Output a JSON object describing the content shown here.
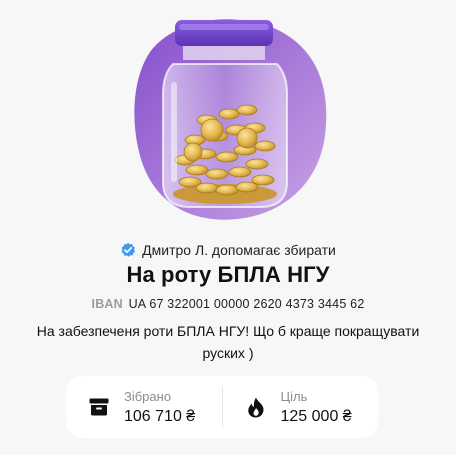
{
  "organizer": {
    "text": "Дмитро Л. допомагає збирати",
    "verified_icon": "verified-check-icon",
    "accent": "#3b9cf0"
  },
  "title": "На роту БПЛА НГУ",
  "iban": {
    "label": "IBAN",
    "number": "UA 67 322001 00000 2620 4373 3445 62"
  },
  "description": "На забезпеченя роти БПЛА НГУ! Що б краще покращувати руских )",
  "stats": {
    "collected": {
      "label": "Зібрано",
      "value": "106 710 ₴",
      "icon": "archive-box-icon"
    },
    "goal": {
      "label": "Ціль",
      "value": "125 000 ₴",
      "icon": "flame-icon"
    }
  },
  "jar": {
    "blob_color": "#b084d8",
    "lid_color": "#6a3fc6",
    "fill_percent": 85.4
  }
}
